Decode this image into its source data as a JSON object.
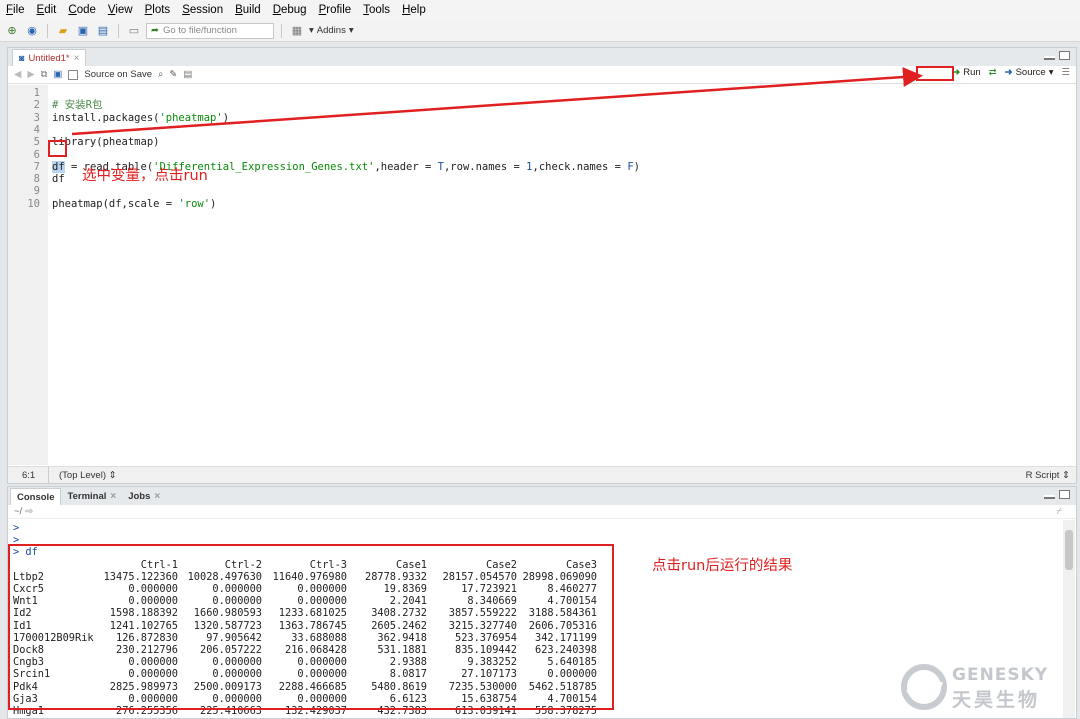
{
  "menu": [
    {
      "ul": "F",
      "rest": "ile"
    },
    {
      "ul": "E",
      "rest": "dit"
    },
    {
      "ul": "C",
      "rest": "ode"
    },
    {
      "ul": "V",
      "rest": "iew"
    },
    {
      "ul": "P",
      "rest": "lots"
    },
    {
      "ul": "S",
      "rest": "ession"
    },
    {
      "ul": "B",
      "rest": "uild"
    },
    {
      "ul": "D",
      "rest": "ebug"
    },
    {
      "ul": "P",
      "rest": "rofile"
    },
    {
      "ul": "T",
      "rest": "ools"
    },
    {
      "ul": "H",
      "rest": "elp"
    }
  ],
  "toolbar": {
    "goto_placeholder": "Go to file/function",
    "addins_label": "Addins"
  },
  "editor": {
    "tab_label": "Untitled1*",
    "source_on_save": "Source on Save",
    "run_label": "Run",
    "source_label": "Source",
    "status_position": "6:1",
    "status_scope": "(Top Level)",
    "status_type": "R Script",
    "line_numbers": [
      "1",
      "2",
      "3",
      "4",
      "5",
      "6",
      "7",
      "8",
      "9",
      "10"
    ],
    "line_1": "# 安装R包",
    "line_2a": "install.packages(",
    "line_2b": "'pheatmap'",
    "line_2c": ")",
    "line_4": "library(pheatmap)",
    "line_6_var": "df",
    "line_6a": " = read.table(",
    "line_6b": "'Differential_Expression_Genes.txt'",
    "line_6c": ",header = ",
    "line_6d": "T",
    "line_6e": ",row.names = ",
    "line_6f": "1",
    "line_6g": ",check.names = ",
    "line_6h": "F",
    "line_6i": ")",
    "line_7": "df",
    "line_9a": "pheatmap(df,scale = ",
    "line_9b": "'row'",
    "line_9c": ")"
  },
  "console": {
    "tab_console": "Console",
    "tab_terminal": "Terminal",
    "tab_jobs": "Jobs",
    "path": "~/",
    "prompt_line_1": ">",
    "prompt_line_2": ">",
    "command_prompt": ">",
    "command": "df",
    "columns": [
      "Ctrl-1",
      "Ctrl-2",
      "Ctrl-3",
      "Case1",
      "Case2",
      "Case3"
    ],
    "rows": [
      {
        "name": "Ltbp2",
        "values": [
          "13475.122360",
          "10028.497630",
          "11640.976980",
          "28778.9332",
          "28157.054570",
          "28998.069090"
        ]
      },
      {
        "name": "Cxcr5",
        "values": [
          "0.000000",
          "0.000000",
          "0.000000",
          "19.8369",
          "17.723921",
          "8.460277"
        ]
      },
      {
        "name": "Wnt1",
        "values": [
          "0.000000",
          "0.000000",
          "0.000000",
          "2.2041",
          "8.340669",
          "4.700154"
        ]
      },
      {
        "name": "Id2",
        "values": [
          "1598.188392",
          "1660.980593",
          "1233.681025",
          "3408.2732",
          "3857.559222",
          "3188.584361"
        ]
      },
      {
        "name": "Id1",
        "values": [
          "1241.102765",
          "1320.587723",
          "1363.786745",
          "2605.2462",
          "3215.327740",
          "2606.705316"
        ]
      },
      {
        "name": "1700012B09Rik",
        "values": [
          "126.872830",
          "97.905642",
          "33.688088",
          "362.9418",
          "523.376954",
          "342.171199"
        ]
      },
      {
        "name": "Dock8",
        "values": [
          "230.212796",
          "206.057222",
          "216.068428",
          "531.1881",
          "835.109442",
          "623.240398"
        ]
      },
      {
        "name": "Cngb3",
        "values": [
          "0.000000",
          "0.000000",
          "0.000000",
          "2.9388",
          "9.383252",
          "5.640185"
        ]
      },
      {
        "name": "Srcin1",
        "values": [
          "0.000000",
          "0.000000",
          "0.000000",
          "8.0817",
          "27.107173",
          "0.000000"
        ]
      },
      {
        "name": "Pdk4",
        "values": [
          "2825.989973",
          "2500.009173",
          "2288.466685",
          "5480.8619",
          "7235.530000",
          "5462.518785"
        ]
      },
      {
        "name": "Gja3",
        "values": [
          "0.000000",
          "0.000000",
          "0.000000",
          "6.6123",
          "15.638754",
          "4.700154"
        ]
      },
      {
        "name": "Hmga1",
        "values": [
          "276.255356",
          "225.410663",
          "132.429037",
          "432.7383",
          "613.039141",
          "558.378275"
        ]
      }
    ]
  },
  "annotations": {
    "select_and_run": "选中变量，点击run",
    "result_note": "点击run后运行的结果",
    "annotation_color": "#e02020"
  },
  "watermark": {
    "brand_en": "GENESKY",
    "brand_cn": "天昊生物"
  },
  "icons": [
    "new-file-icon",
    "open-project-icon",
    "save-icon",
    "save-all-icon",
    "print-icon",
    "goto-arrow-icon",
    "grid-icon",
    "back-icon",
    "forward-icon",
    "show-in-window-icon",
    "search-icon",
    "wand-icon",
    "compile-icon",
    "run-arrow-icon",
    "rerun-icon",
    "source-icon",
    "outline-icon",
    "home-icon",
    "broom-icon"
  ]
}
